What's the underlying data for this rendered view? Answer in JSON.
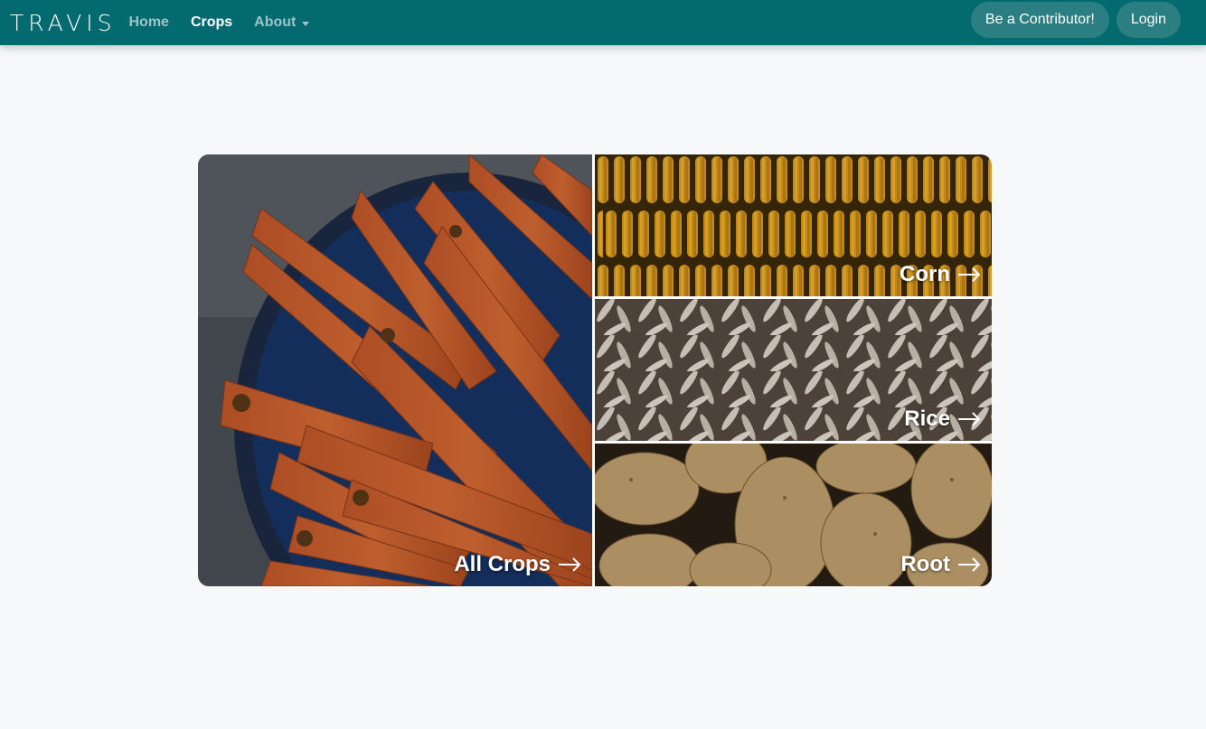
{
  "brand": {
    "name": "TRAVIS"
  },
  "nav": {
    "links": [
      {
        "label": "Home",
        "active": false
      },
      {
        "label": "Crops",
        "active": true
      },
      {
        "label": "About",
        "active": false,
        "dropdown": true
      }
    ],
    "contributor_label": "Be a Contributor!",
    "login_label": "Login"
  },
  "tiles": {
    "all_crops": {
      "label": "All Crops",
      "image": "carrots"
    },
    "corn": {
      "label": "Corn",
      "image": "corn-cobs"
    },
    "rice": {
      "label": "Rice",
      "image": "rice-grains"
    },
    "root": {
      "label": "Root",
      "image": "potatoes"
    }
  },
  "colors": {
    "navbar": "#036b70",
    "nav_active": "#ffffff",
    "nav_inactive": "#9dc4c6",
    "pill_button": "#2b7f83",
    "page_bg": "#f7f8fa"
  },
  "icons": {
    "arrow": "arrow-right-icon",
    "caret": "chevron-down-icon"
  }
}
